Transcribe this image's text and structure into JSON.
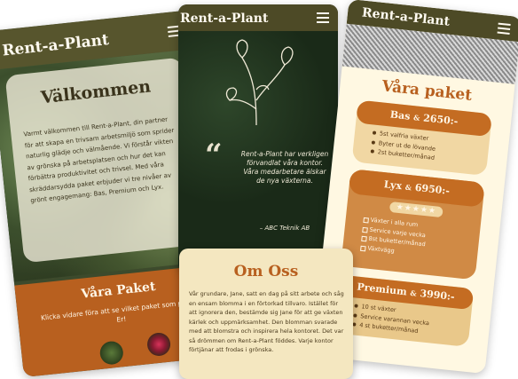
{
  "left_screen": {
    "brand": "Rent-a-Plant",
    "welcome_title": "Välkommen",
    "welcome_text": "Varmt välkommen till Rent-a-Plant, din partner för att skapa en trivsam arbetsmiljö som sprider naturlig glädje och välmående. Vi förstår vikten av grönska på arbetsplatsen och hur det kan förbättra produktivitet och trivsel. Med våra skräddarsydda paket erbjuder vi tre nivåer av grönt engagemang: Bas, Premium och Lyx.",
    "paket_title": "Våra Paket",
    "paket_text": "Klicka vidare föra att se vilket paket som passar Er!"
  },
  "middle_screen": {
    "brand": "Rent-a-Plant",
    "quote_mark": "“",
    "quote_text": "Rent-a-Plant har verkligen förvandlat våra kontor. Våra medarbetare älskar de nya växterna.",
    "quote_author": "– ABC Teknik AB"
  },
  "right_screen": {
    "brand": "Rent-a-Plant",
    "section_title": "Våra paket",
    "packages": [
      {
        "name": "Bas",
        "price": "2650:-",
        "features": [
          "5st valfria växter",
          "Byter ut de lövande",
          "2st buketter/månad"
        ]
      },
      {
        "name": "Lyx",
        "price": "6950:-",
        "features": [
          "Växter i alla rum",
          "Service varje vecka",
          "8st buketter/månad",
          "Växtvägg"
        ]
      },
      {
        "name": "Premium",
        "price": "3990:-",
        "features": [
          "10 st växter",
          "Service varannan vecka",
          "4 st buketter/månad"
        ]
      }
    ],
    "amp": "&",
    "stars": "★★★★★"
  },
  "om_oss": {
    "title": "Om Oss",
    "text": "Vår grundare, Jane, satt en dag på sitt arbete och såg en ensam blomma i en förtorkad tillvaro. Istället för att ignorera den, bestämde sig Jane för att ge växten kärlek och uppmärksamhet. Den blomman svarade med att blomstra och inspirera hela kontoret. Det var så drömmen om Rent-a-Plant föddes. Varje kontor förtjänar att frodas i grönska."
  },
  "colors": {
    "olive": "#4d4a26",
    "orange": "#b8601f",
    "cream": "#fff8e2",
    "sand": "#f1d7a3"
  }
}
